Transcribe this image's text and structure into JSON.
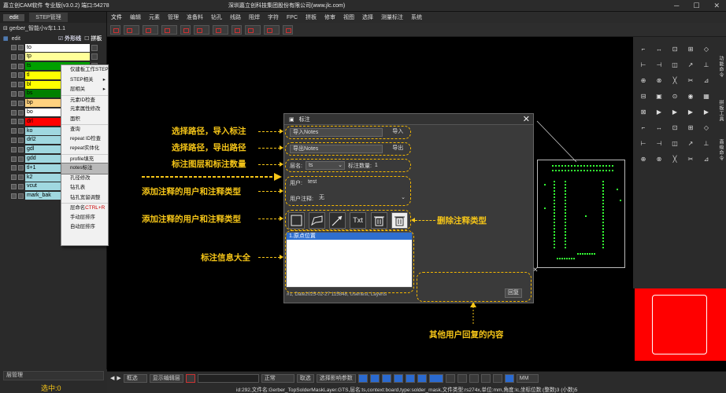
{
  "titlebar": {
    "app_title": "嘉立创CAM软件 专业版(v3.0.2) 端口:54278",
    "company": "深圳嘉立创科技集团股份有限公司(www.jlc.com)"
  },
  "menu": [
    "文件",
    "编辑",
    "元素",
    "管理",
    "准备料",
    "钻孔",
    "线路",
    "阻焊",
    "字符",
    "FPC",
    "拼板",
    "修审",
    "视图",
    "选择",
    "测量标注",
    "系统"
  ],
  "left_panel": {
    "tabs": [
      "edit",
      "STEP管理"
    ],
    "tree_root": "gerber_智能小v车1.1.1",
    "step_name": "edit",
    "outline_label": "外形线",
    "panel_label": "拼板",
    "layers": [
      {
        "name": "to",
        "color": "#ffffff"
      },
      {
        "name": "tp",
        "color": "#ffff99"
      },
      {
        "name": "ts",
        "color": "#00a000"
      },
      {
        "name": "tl",
        "color": "#ffff00"
      },
      {
        "name": "bl",
        "color": "#ffff00"
      },
      {
        "name": "bs",
        "color": "#008000"
      },
      {
        "name": "bp",
        "color": "#ffd27f"
      },
      {
        "name": "bo",
        "color": "#ffffff"
      },
      {
        "name": "drl",
        "color": "#ff0000"
      },
      {
        "name": "ko",
        "color": "#a0d8e0"
      },
      {
        "name": "drl2",
        "color": "#a0d8e0"
      },
      {
        "name": "gdl",
        "color": "#a0d8e0"
      },
      {
        "name": "gdd",
        "color": "#a0d8e0"
      },
      {
        "name": "tl+1",
        "color": "#a0d8e0"
      },
      {
        "name": "k2",
        "color": "#a0d8e0"
      },
      {
        "name": "vcut",
        "color": "#a0d8e0"
      },
      {
        "name": "mark_bak",
        "color": "#a0d8e0"
      }
    ],
    "manager_label": "层管理",
    "selected_label": "选中:0"
  },
  "context_menu": {
    "items": [
      {
        "label": "仅建板工作STEP",
        "arrow": false
      },
      {
        "label": "STEP相关",
        "arrow": true
      },
      {
        "label": "层相关",
        "arrow": true
      },
      {
        "label": "元素ID检查",
        "arrow": false
      },
      {
        "label": "元素属性修改",
        "arrow": false
      },
      {
        "label": "面积",
        "arrow": false
      },
      {
        "label": "查询",
        "arrow": false
      },
      {
        "label": "repeat ID检查",
        "arrow": false
      },
      {
        "label": "repeat实体化",
        "arrow": false
      },
      {
        "label": "profile填充",
        "arrow": false
      },
      {
        "label": "notes标注",
        "arrow": false,
        "highlight": true
      },
      {
        "label": "孔径修改",
        "arrow": false
      },
      {
        "label": "钻孔表",
        "arrow": false
      },
      {
        "label": "钻孔宽留调整",
        "arrow": false
      },
      {
        "label": "层命名",
        "shortcut": "CTRL+R",
        "arrow": false
      },
      {
        "label": "手动层排序",
        "arrow": false
      },
      {
        "label": "自动层排序",
        "arrow": false
      }
    ]
  },
  "dialog": {
    "title": "标注",
    "import_label": "导入Notes",
    "import_btn": "导入",
    "export_label": "导出Notes",
    "export_btn": "导出",
    "layer_label": "层名:",
    "layer_value": "ts",
    "count_label": "标注数量:",
    "count_value": "1",
    "user_label": "用户:",
    "user_value": "test",
    "note_label": "用户注释:",
    "note_value": "无",
    "tool_text": "Txt",
    "list_items": [
      "1.原点位置"
    ],
    "footer": "#1, Date2025-02-27 115848, Usertest, Layerts",
    "reply_btn": "回复"
  },
  "annotations": {
    "import": "选择路径，导入标注",
    "export": "选择路径，导出路径",
    "layer_count": "标注图层和标注数量",
    "add_user": "添加注释的用户和注释类型",
    "add_type": "添加注释的用户和注释类型",
    "delete": "删除注释类型",
    "info": "标注信息大全",
    "reply": "其他用户回复的内容"
  },
  "right_panel": {
    "vertical_labels": [
      "功能命令",
      "拼板工具",
      "高级命令"
    ]
  },
  "statusbar": {
    "mode_select": "框选",
    "display_label": "显示编辑层",
    "snap_label": "正常",
    "select_label": "取选",
    "select_all_label": "选择影响参数",
    "unit_value": "MM",
    "info_text": "id:292,文件名:Gerber_TopSolderMaskLayer.GTS,层名:ts,context:board,type:solder_mask,文件类型:rs274x,单位:mm,角度:lc,坐标位数:(整数)3 (小数)5"
  }
}
